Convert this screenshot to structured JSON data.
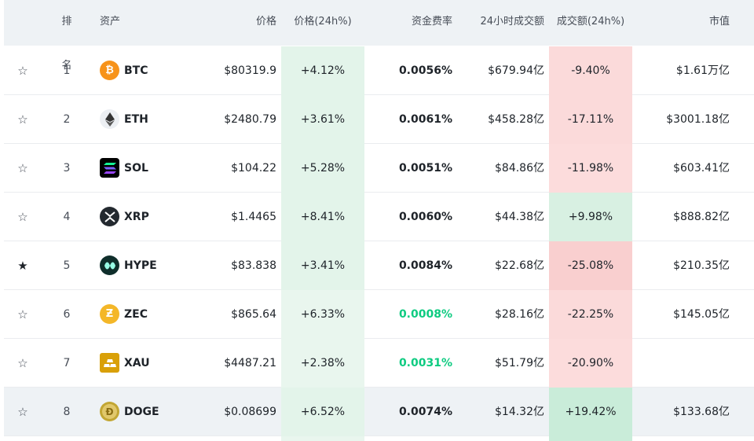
{
  "header": {
    "rank": "排名",
    "asset": "资产",
    "price": "价格",
    "change": "价格(24h%)",
    "funding": "资金费率",
    "volume": "24小时成交额",
    "volume_change": "成交额(24h%)",
    "market_cap": "市值"
  },
  "rows": [
    {
      "rank": "1",
      "symbol": "BTC",
      "icon": "bitcoin-icon",
      "price": "$80319.9",
      "change": "+4.12%",
      "funding": "0.0056%",
      "volume": "$679.94亿",
      "volume_change": "-9.40%",
      "market_cap": "$1.61万亿",
      "starred": false
    },
    {
      "rank": "2",
      "symbol": "ETH",
      "icon": "ethereum-icon",
      "price": "$2480.79",
      "change": "+3.61%",
      "funding": "0.0061%",
      "volume": "$458.28亿",
      "volume_change": "-17.11%",
      "market_cap": "$3001.18亿",
      "starred": false
    },
    {
      "rank": "3",
      "symbol": "SOL",
      "icon": "solana-icon",
      "price": "$104.22",
      "change": "+5.28%",
      "funding": "0.0051%",
      "volume": "$84.86亿",
      "volume_change": "-11.98%",
      "market_cap": "$603.41亿",
      "starred": false
    },
    {
      "rank": "4",
      "symbol": "XRP",
      "icon": "xrp-icon",
      "price": "$1.4465",
      "change": "+8.41%",
      "funding": "0.0060%",
      "volume": "$44.38亿",
      "volume_change": "+9.98%",
      "market_cap": "$888.82亿",
      "starred": false
    },
    {
      "rank": "5",
      "symbol": "HYPE",
      "icon": "hyperliquid-icon",
      "price": "$83.838",
      "change": "+3.41%",
      "funding": "0.0084%",
      "volume": "$22.68亿",
      "volume_change": "-25.08%",
      "market_cap": "$210.35亿",
      "starred": true
    },
    {
      "rank": "6",
      "symbol": "ZEC",
      "icon": "zcash-icon",
      "price": "$865.64",
      "change": "+6.33%",
      "funding": "0.0008%",
      "volume": "$28.16亿",
      "volume_change": "-22.25%",
      "market_cap": "$145.05亿",
      "starred": false
    },
    {
      "rank": "7",
      "symbol": "XAU",
      "icon": "gold-bars-icon",
      "price": "$4487.21",
      "change": "+2.38%",
      "funding": "0.0031%",
      "volume": "$51.79亿",
      "volume_change": "-20.90%",
      "market_cap": "",
      "starred": false
    },
    {
      "rank": "8",
      "symbol": "DOGE",
      "icon": "dogecoin-icon",
      "price": "$0.08699",
      "change": "+6.52%",
      "funding": "0.0074%",
      "volume": "$14.32亿",
      "volume_change": "+19.42%",
      "market_cap": "$133.68亿",
      "starred": false
    }
  ],
  "colors": {
    "positive": "#0ecb81",
    "negative_bg": "#fbdada",
    "positive_bg": "#e3f4ea",
    "header_bg": "#eef2f5"
  }
}
